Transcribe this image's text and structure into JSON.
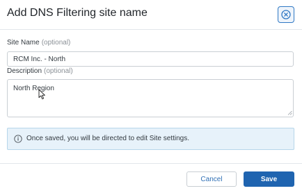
{
  "dialog": {
    "title": "Add DNS Filtering site name",
    "close_icon": "close-circle-icon"
  },
  "site_name": {
    "label": "Site Name",
    "optional": "(optional)",
    "value": "RCM Inc. - North"
  },
  "description": {
    "label": "Description",
    "optional": "(optional)",
    "value": "North Region"
  },
  "info": {
    "icon": "info-icon",
    "text": "Once saved, you will be directed to edit Site settings."
  },
  "footer": {
    "cancel_label": "Cancel",
    "save_label": "Save"
  },
  "colors": {
    "primary": "#1f64b0",
    "info_background": "#e7f2fa",
    "info_border": "#b6d6ea"
  }
}
